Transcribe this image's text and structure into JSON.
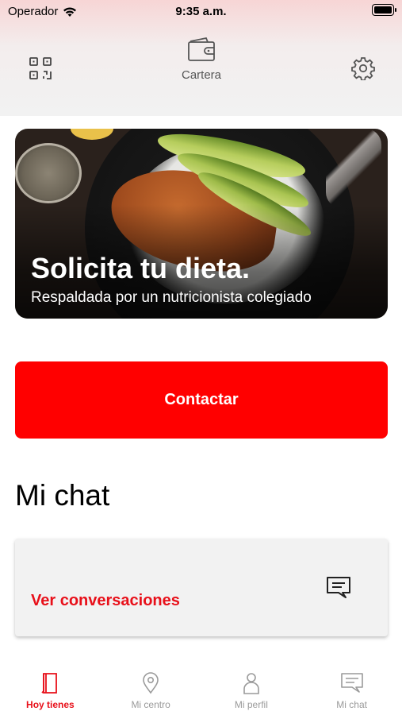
{
  "status_bar": {
    "carrier": "Operador",
    "time": "9:35 a.m."
  },
  "header": {
    "wallet_label": "Cartera",
    "icons": [
      "qr-code-icon",
      "wallet-icon",
      "gear-icon"
    ]
  },
  "banner": {
    "title": "Solicita tu dieta.",
    "subtitle": "Respaldada por un nutricionista colegiado"
  },
  "contact": {
    "label": "Contactar"
  },
  "chat_section": {
    "title": "Mi chat",
    "link": "Ver conversaciones",
    "icon": "chat-bubble-icon"
  },
  "tabbar": {
    "items": [
      {
        "label": "Hoy tienes",
        "icon": "book-icon",
        "active": true
      },
      {
        "label": "Mi centro",
        "icon": "location-pin-icon",
        "active": false
      },
      {
        "label": "Mi perfil",
        "icon": "person-icon",
        "active": false
      },
      {
        "label": "Mi chat",
        "icon": "chat-bubble-icon",
        "active": false
      }
    ]
  },
  "colors": {
    "accent": "#ff0000",
    "link_red": "#e8101a",
    "tab_inactive": "#9a9a9a"
  }
}
